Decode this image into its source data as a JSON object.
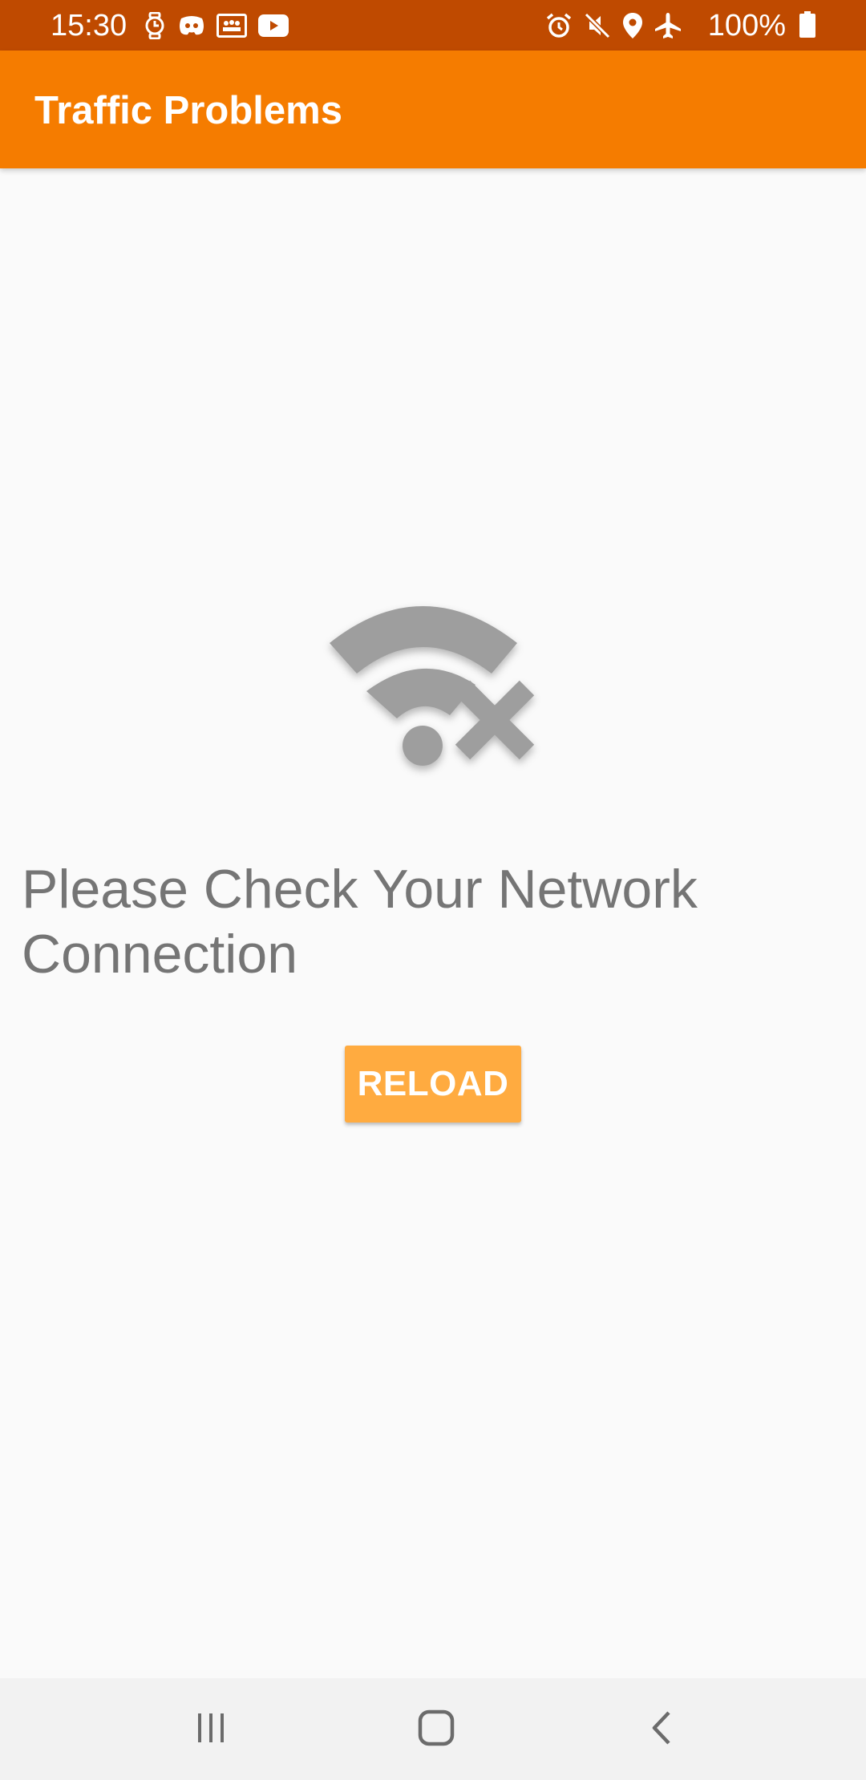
{
  "status_bar": {
    "time": "15:30",
    "battery_level": "100%",
    "left_icons": [
      "watch-icon",
      "discord-icon",
      "teams-icon",
      "youtube-icon"
    ],
    "right_icons": [
      "alarm-icon",
      "mute-icon",
      "location-icon",
      "airplane-mode-icon",
      "battery-icon"
    ],
    "background_color": "#bf4a00"
  },
  "app_bar": {
    "title": "Traffic Problems",
    "background_color": "#f57c00"
  },
  "content": {
    "icon": "no-wifi-icon",
    "message": "Please Check Your Network Connection",
    "reload_label": "RELOAD",
    "reload_color": "#ffab40"
  },
  "nav_bar": {
    "buttons": [
      "recents-icon",
      "home-icon",
      "back-icon"
    ]
  }
}
